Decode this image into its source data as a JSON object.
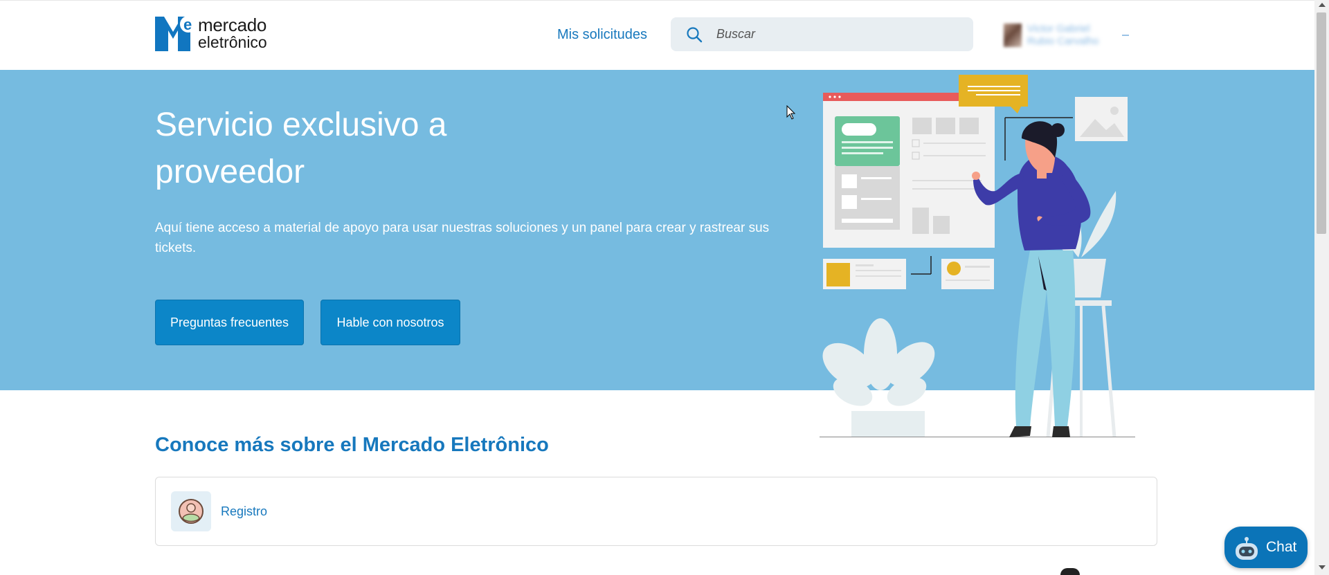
{
  "header": {
    "logo": {
      "line1": "mercado",
      "line2": "eletrônico"
    },
    "nav_link": "Mis solicitudes",
    "search": {
      "placeholder": "Buscar"
    },
    "user": {
      "name_line1": "Victor Gabriel",
      "name_line2": "Rubio Carvalho"
    }
  },
  "hero": {
    "title": "Servicio exclusivo a proveedor",
    "description": "Aquí tiene acceso a material de apoyo para usar nuestras soluciones y un panel para crear y rastrear sus tickets.",
    "buttons": {
      "faq": "Preguntas frecuentes",
      "talk": "Hable con nosotros"
    }
  },
  "section": {
    "title": "Conoce más sobre el Mercado Eletrônico",
    "cards": [
      {
        "label": "Registro",
        "icon": "user-register-icon"
      }
    ]
  },
  "chat": {
    "label": "Chat"
  },
  "colors": {
    "brand": "#1778bd",
    "hero_bg": "#76bbe0",
    "button": "#0c86c8",
    "chat": "#0b74b8"
  }
}
